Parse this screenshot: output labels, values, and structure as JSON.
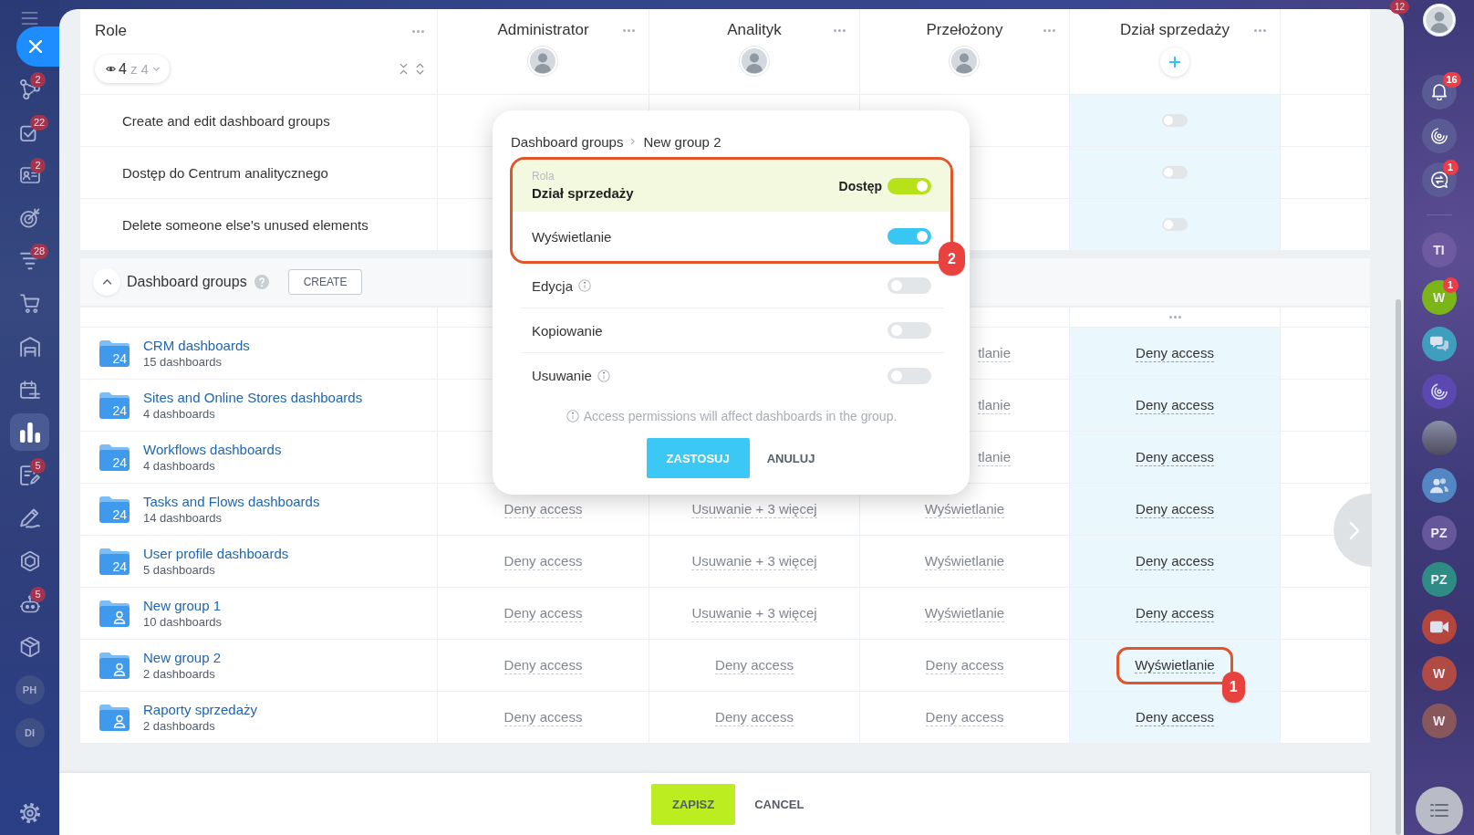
{
  "left_sidebar": {
    "items": [
      {
        "kind": "icon",
        "badge": "2",
        "selected": false
      },
      {
        "kind": "icon",
        "badge": "22",
        "selected": false
      },
      {
        "kind": "icon",
        "badge": "2",
        "selected": false
      },
      {
        "kind": "icon",
        "selected": false
      },
      {
        "kind": "icon",
        "badge": "28",
        "selected": false
      },
      {
        "kind": "icon",
        "selected": false
      },
      {
        "kind": "icon",
        "selected": false
      },
      {
        "kind": "icon",
        "selected": false
      },
      {
        "kind": "icon",
        "selected": true
      },
      {
        "kind": "icon",
        "badge": "5",
        "selected": false
      },
      {
        "kind": "icon",
        "selected": false
      },
      {
        "kind": "icon",
        "selected": false
      },
      {
        "kind": "icon",
        "badge": "5",
        "selected": false
      },
      {
        "kind": "icon",
        "selected": false
      },
      {
        "kind": "initials",
        "label": "PH",
        "selected": false
      },
      {
        "kind": "initials",
        "label": "DI",
        "selected": false
      }
    ]
  },
  "top_badge": "12",
  "role_table": {
    "role_header": {
      "title": "Role",
      "visible_count": "4",
      "total": "z 4"
    },
    "roles": [
      {
        "name": "Administrator",
        "kind": "avatar",
        "selected": false
      },
      {
        "name": "Analityk",
        "kind": "avatar",
        "selected": false
      },
      {
        "name": "Przełożony",
        "kind": "avatar",
        "selected": false
      },
      {
        "name": "Dział sprzedaży",
        "kind": "add",
        "selected": true
      }
    ],
    "permissions": [
      {
        "label": "Create and edit dashboard groups",
        "cells": [
          null,
          null,
          null,
          {
            "kind": "toggle",
            "on": false
          }
        ]
      },
      {
        "label": "Dostęp do Centrum analitycznego",
        "cells": [
          null,
          null,
          null,
          {
            "kind": "toggle",
            "on": false
          }
        ]
      },
      {
        "label": "Delete someone else's unused elements",
        "cells": [
          null,
          null,
          null,
          {
            "kind": "toggle",
            "on": false
          }
        ]
      }
    ],
    "section": {
      "title": "Dashboard groups",
      "expanded": true,
      "create_label": "CREATE"
    },
    "groups": [
      {
        "name": "CRM dashboards",
        "count": "15 dashboards",
        "folder": {
          "kind": "logo",
          "label": "24"
        },
        "cells": [
          null,
          null,
          {
            "kind": "cut",
            "text": "tlanie"
          },
          {
            "kind": "link",
            "text": "Deny access"
          }
        ]
      },
      {
        "name": "Sites and Online Stores dashboards",
        "count": "4 dashboards",
        "folder": {
          "kind": "logo",
          "label": "24"
        },
        "cells": [
          null,
          null,
          {
            "kind": "cut",
            "text": "tlanie"
          },
          {
            "kind": "link",
            "text": "Deny access"
          }
        ]
      },
      {
        "name": "Workflows dashboards",
        "count": "4 dashboards",
        "folder": {
          "kind": "logo",
          "label": "24"
        },
        "cells": [
          null,
          null,
          {
            "kind": "cut",
            "text": "tlanie"
          },
          {
            "kind": "link",
            "text": "Deny access"
          }
        ]
      },
      {
        "name": "Tasks and Flows dashboards",
        "count": "14 dashboards",
        "folder": {
          "kind": "logo",
          "label": "24"
        },
        "cells": [
          {
            "kind": "link",
            "text": "Deny access"
          },
          {
            "kind": "link",
            "text": "Usuwanie + 3 więcej"
          },
          {
            "kind": "link",
            "text": "Wyświetlanie"
          },
          {
            "kind": "link",
            "text": "Deny access"
          }
        ]
      },
      {
        "name": "User profile dashboards",
        "count": "5 dashboards",
        "folder": {
          "kind": "logo",
          "label": "24"
        },
        "cells": [
          {
            "kind": "link",
            "text": "Deny access"
          },
          {
            "kind": "link",
            "text": "Usuwanie + 3 więcej"
          },
          {
            "kind": "link",
            "text": "Wyświetlanie"
          },
          {
            "kind": "link",
            "text": "Deny access"
          }
        ]
      },
      {
        "name": "New group 1",
        "count": "10 dashboards",
        "folder": {
          "kind": "person"
        },
        "cells": [
          {
            "kind": "link",
            "text": "Deny access"
          },
          {
            "kind": "link",
            "text": "Usuwanie + 3 więcej"
          },
          {
            "kind": "link",
            "text": "Wyświetlanie"
          },
          {
            "kind": "link",
            "text": "Deny access"
          }
        ]
      },
      {
        "name": "New group 2",
        "count": "2 dashboards",
        "folder": {
          "kind": "person"
        },
        "cells": [
          {
            "kind": "link",
            "text": "Deny access"
          },
          {
            "kind": "link",
            "text": "Deny access"
          },
          {
            "kind": "link",
            "text": "Deny access"
          },
          {
            "kind": "link",
            "text": "Wyświetlanie",
            "callout": "1"
          }
        ]
      },
      {
        "name": "Raporty sprzedaży",
        "count": "2 dashboards",
        "folder": {
          "kind": "person"
        },
        "cells": [
          {
            "kind": "link",
            "text": "Deny access"
          },
          {
            "kind": "link",
            "text": "Deny access"
          },
          {
            "kind": "link",
            "text": "Deny access"
          },
          {
            "kind": "link",
            "text": "Deny access"
          }
        ]
      }
    ]
  },
  "access_popup": {
    "breadcrumb": [
      "Dashboard groups",
      "New group 2"
    ],
    "role": {
      "caption": "Rola",
      "name": "Dział sprzedaży",
      "access_label": "Dostęp",
      "access_on": true
    },
    "callout": "2",
    "permissions": [
      {
        "label": "Wyświetlanie",
        "on": true,
        "info": false,
        "framed": true
      },
      {
        "label": "Edycja",
        "on": false,
        "info": true,
        "framed": false
      },
      {
        "label": "Kopiowanie",
        "on": false,
        "info": false,
        "framed": false
      },
      {
        "label": "Usuwanie",
        "on": false,
        "info": true,
        "framed": false
      }
    ],
    "note": "Access permissions will affect dashboards in the group.",
    "buttons": [
      {
        "kind": "primary",
        "label": "ZASTOSUJ"
      },
      {
        "kind": "plain",
        "label": "ANULUJ"
      }
    ]
  },
  "footer": {
    "buttons": [
      {
        "kind": "primary",
        "label": "ZAPISZ"
      },
      {
        "kind": "plain",
        "label": "CANCEL"
      }
    ]
  },
  "right_sidebar": {
    "tools": [
      {
        "kind": "icon",
        "badge": "16"
      },
      {
        "kind": "icon"
      },
      {
        "kind": "icon",
        "badge": "1"
      }
    ],
    "chats": [
      {
        "kind": "initials",
        "label": "TI",
        "color": "#6e5b9f"
      },
      {
        "kind": "initials",
        "label": "W",
        "color": "#7cb518",
        "badge": "1"
      },
      {
        "kind": "icon",
        "color": "#3f9dbd"
      },
      {
        "kind": "icon",
        "color": "#5b48b0"
      },
      {
        "kind": "photo"
      },
      {
        "kind": "icon",
        "color": "#5287c4"
      },
      {
        "kind": "initials",
        "label": "PZ",
        "color": "#66579b"
      },
      {
        "kind": "initials",
        "label": "PZ",
        "color": "#2f8c84"
      },
      {
        "kind": "icon",
        "color": "#b5463e"
      },
      {
        "kind": "initials",
        "label": "W",
        "color": "#b04a44"
      },
      {
        "kind": "initials",
        "label": "W",
        "color": "#87575c"
      }
    ]
  }
}
